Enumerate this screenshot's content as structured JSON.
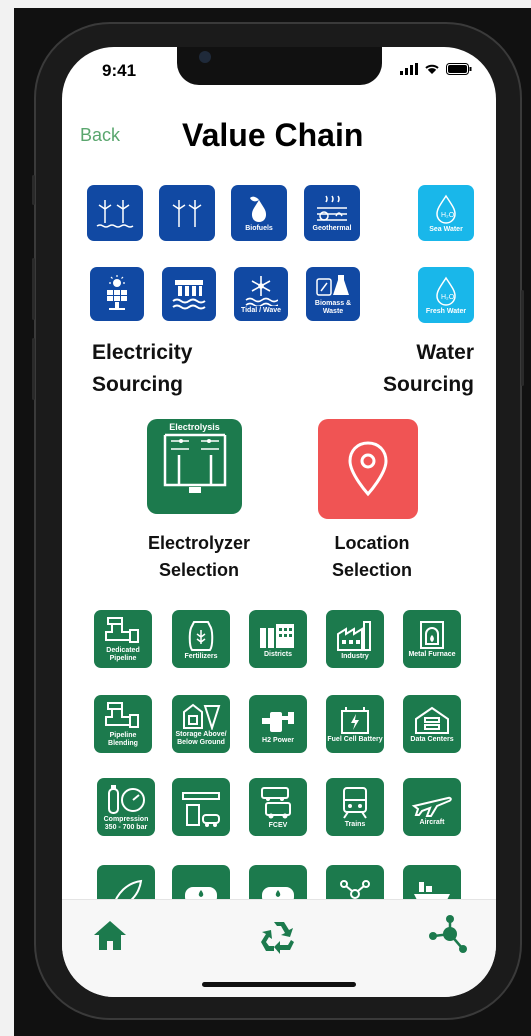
{
  "status_bar": {
    "time": "9:41"
  },
  "header": {
    "back_label": "Back",
    "title": "Value Chain"
  },
  "electricity": {
    "label_line1": "Electricity",
    "label_line2": "Sourcing",
    "tiles": [
      {
        "name": "offshore-wind",
        "label": ""
      },
      {
        "name": "onshore-wind",
        "label": ""
      },
      {
        "name": "biofuels",
        "label": "Biofuels"
      },
      {
        "name": "geothermal",
        "label": "Geothermal"
      },
      {
        "name": "solar",
        "label": ""
      },
      {
        "name": "hydro",
        "label": ""
      },
      {
        "name": "tidal-wave",
        "label": "Tidal / Wave"
      },
      {
        "name": "biomass-waste",
        "label": "Biomass & Waste"
      }
    ]
  },
  "water": {
    "label_line1": "Water",
    "label_line2": "Sourcing",
    "tiles": [
      {
        "name": "sea-water",
        "label": "Sea Water"
      },
      {
        "name": "fresh-water",
        "label": "Fresh Water"
      }
    ]
  },
  "electrolyzer": {
    "tile_label": "Electrolysis",
    "caption_line1": "Electrolyzer",
    "caption_line2": "Selection"
  },
  "location": {
    "caption_line1": "Location",
    "caption_line2": "Selection"
  },
  "uses": [
    {
      "label": "Dedicated Pipeline"
    },
    {
      "label": "Fertilizers"
    },
    {
      "label": "Districts"
    },
    {
      "label": "Industry"
    },
    {
      "label": "Metal Furnace"
    },
    {
      "label": "Pipeline Blending"
    },
    {
      "label": "Storage Above/ Below Ground"
    },
    {
      "label": "H2 Power"
    },
    {
      "label": "Fuel Cell Battery"
    },
    {
      "label": "Data Centers"
    },
    {
      "label": "Compression 350 - 700 bar"
    },
    {
      "label": ""
    },
    {
      "label": "FCEV"
    },
    {
      "label": "Trains"
    },
    {
      "label": "Aircraft"
    }
  ],
  "colors": {
    "blue": "#1149a3",
    "cyan": "#19b7ea",
    "green": "#1c7a4d",
    "red": "#f05454",
    "back": "#5aa66e"
  },
  "tabbar": {
    "items": [
      "home-icon",
      "recycle-icon",
      "network-icon"
    ]
  }
}
